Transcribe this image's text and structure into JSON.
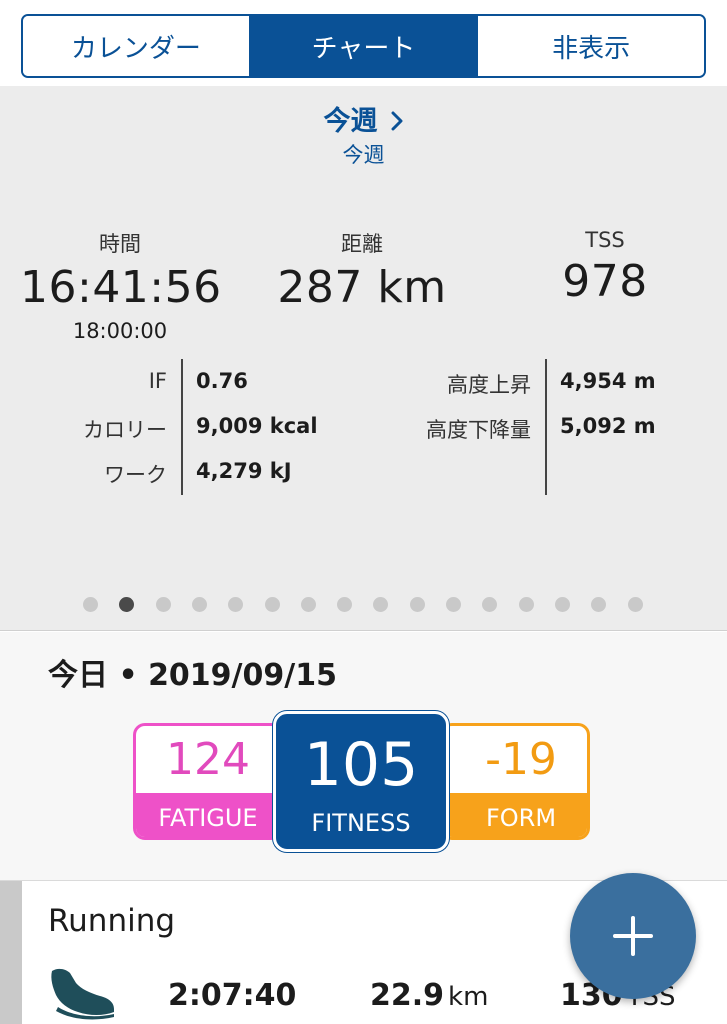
{
  "tabs": [
    {
      "label": "カレンダー",
      "active": false
    },
    {
      "label": "チャート",
      "active": true
    },
    {
      "label": "非表示",
      "active": false
    }
  ],
  "summary": {
    "period_title": "今週",
    "period_sub": "今週",
    "time": {
      "label": "時間",
      "value": "16:41:56",
      "planned": "18:00:00"
    },
    "distance": {
      "label": "距離",
      "value": "287 km"
    },
    "tss": {
      "label": "TSS",
      "value": "978"
    },
    "left_details": [
      {
        "label": "IF",
        "value": "0.76"
      },
      {
        "label": "カロリー",
        "value": "9,009 kcal"
      },
      {
        "label": "ワーク",
        "value": "4,279 kJ"
      }
    ],
    "right_details": [
      {
        "label": "高度上昇",
        "value": "4,954 m"
      },
      {
        "label": "高度下降量",
        "value": "5,092 m"
      }
    ],
    "pager": {
      "count": 16,
      "active_index": 1
    }
  },
  "today": {
    "date_label": "今日 • 2019/09/15",
    "fatigue": {
      "value": "124",
      "label": "FATIGUE"
    },
    "fitness": {
      "value": "105",
      "label": "FITNESS"
    },
    "form": {
      "value": "-19",
      "label": "FORM"
    }
  },
  "activity": {
    "title": "Running",
    "icon": "running-shoe-icon",
    "duration": "2:07:40",
    "distance": "22.9",
    "distance_unit": "km",
    "tss": "130",
    "tss_unit": "TSS"
  },
  "fab": {
    "icon": "plus-icon"
  },
  "colors": {
    "brand_blue": "#0a5196",
    "fatigue_pink": "#ee51c8",
    "form_orange": "#f7a21b",
    "fab_blue": "#3a6f9e"
  }
}
